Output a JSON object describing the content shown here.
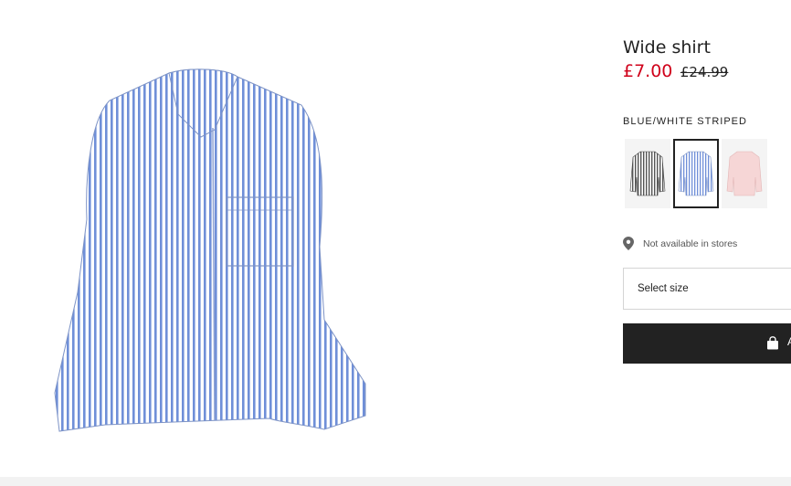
{
  "product": {
    "title": "Wide shirt",
    "price_sale": "£7.00",
    "price_old": "£24.99",
    "color_label": "BLUE/WHITE STRIPED",
    "swatches": [
      {
        "name": "grey-striped",
        "selected": false
      },
      {
        "name": "blue-white-striped",
        "selected": true
      },
      {
        "name": "light-pink",
        "selected": false
      }
    ],
    "store_availability": "Not available in stores",
    "size_select_label": "Select size",
    "add_button_label": "Add",
    "colors": {
      "sale_price": "#d0021b",
      "button_bg": "#222222",
      "stripe_blue": "#6f8fd8"
    }
  },
  "icons": {
    "location": "location-pin-icon",
    "bag": "shopping-bag-icon"
  }
}
